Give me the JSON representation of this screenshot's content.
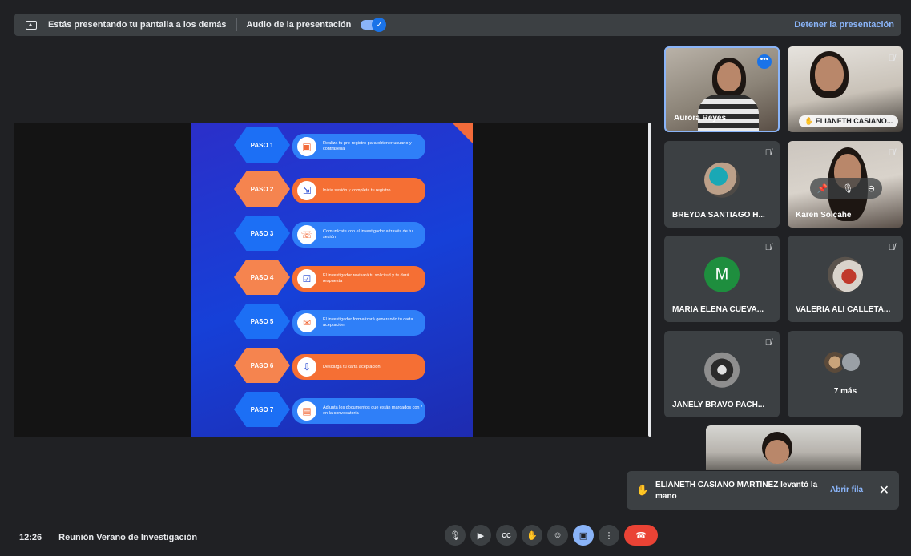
{
  "topbar": {
    "presenting_text": "Estás presentando tu pantalla a los demás",
    "audio_label": "Audio de la presentación",
    "audio_check": "✓",
    "stop_label": "Detener la presentación"
  },
  "slide": {
    "steps": [
      {
        "label": "PASO 1",
        "text": "Realiza tu pre-registro para obtener usuario y contraseña",
        "icon": "▣",
        "color": "blue"
      },
      {
        "label": "PASO 2",
        "text": "Inicia sesión y completa tu registro",
        "icon": "⇲",
        "color": "orange"
      },
      {
        "label": "PASO 3",
        "text": "Comunícate con el investigador a través de tu sesión",
        "icon": "☏",
        "color": "blue"
      },
      {
        "label": "PASO 4",
        "text": "El investigador revisará tu solicitud y te dará respuesta",
        "icon": "☑",
        "color": "orange"
      },
      {
        "label": "PASO 5",
        "text": "El investigador formalizará generando tu carta aceptación",
        "icon": "✉",
        "color": "blue"
      },
      {
        "label": "PASO 6",
        "text": "Descarga tu carta aceptación",
        "icon": "⇩",
        "color": "orange"
      },
      {
        "label": "PASO 7",
        "text": "Adjunta los documentos que están marcados con * en la convocatoria",
        "icon": "▤",
        "color": "blue"
      }
    ]
  },
  "participants": {
    "aurora": "Aurora Reyes",
    "elianeth": "ELIANETH CASIANO...",
    "breyda": "BREYDA SANTIAGO H...",
    "karen": "Karen Solcahe",
    "maria": "MARIA ELENA CUEVA...",
    "maria_initial": "M",
    "maria_color": "#1e8e3e",
    "valeria": "VALERIA ALI CALLETA...",
    "janely": "JANELY BRAVO PACH...",
    "more": "7 más"
  },
  "notification": {
    "message": "ELIANETH CASIANO MARTINEZ levantó la mano",
    "action": "Abrir fila",
    "close": "✕"
  },
  "footer": {
    "time": "12:26",
    "meeting": "Reunión Verano de Investigación"
  },
  "controls": {
    "mic": "🎙",
    "camera": "▶",
    "captions": "CC",
    "hand": "✋",
    "emoji": "☺",
    "present": "▣",
    "more": "⋮",
    "end": "☎"
  }
}
